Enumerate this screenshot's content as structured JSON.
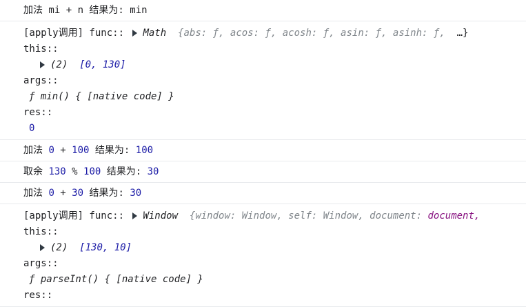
{
  "logs": {
    "l1": "加法 mi + n 结果为: min",
    "b1": {
      "prefix": "[apply调用] func::",
      "object_name": "Math",
      "preview": "{abs: ƒ, acos: ƒ, acosh: ƒ, asin: ƒ, asinh: ƒ,",
      "ellipsis": "…}",
      "this_label": "this::",
      "this_array_len": "(2)",
      "this_array": "[0, 130]",
      "args_label": "args::",
      "args_func": "ƒ min() { [native code] }",
      "res_label": "res::",
      "res_value": "0"
    },
    "l2": {
      "pre": "加法 ",
      "a": "0",
      "op": " + ",
      "b": "100",
      "mid": " 结果为: ",
      "r": "100"
    },
    "l3": {
      "pre": "取余 ",
      "a": "130",
      "op": " % ",
      "b": "100",
      "mid": " 结果为: ",
      "r": "30"
    },
    "l4": {
      "pre": "加法 ",
      "a": "0",
      "op": " + ",
      "b": "30",
      "mid": " 结果为: ",
      "r": "30"
    },
    "b2": {
      "prefix": "[apply调用] func::",
      "object_name": "Window",
      "preview_a": "{window: Window, self: Window, document:",
      "preview_b": "document,",
      "this_label": "this::",
      "this_array_len": "(2)",
      "this_array": "[130, 10]",
      "args_label": "args::",
      "args_func": "ƒ parseInt() { [native code] }",
      "res_label": "res::"
    }
  }
}
